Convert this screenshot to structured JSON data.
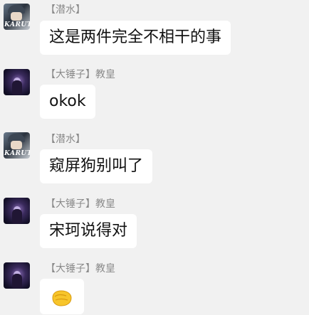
{
  "messages": [
    {
      "sender": "【潜水】",
      "text": "这是两件完全不相干的事",
      "avatar": "naruto-avatar"
    },
    {
      "sender": "【大锤子】教皇",
      "text": "okok",
      "avatar": "night-avatar"
    },
    {
      "sender": "【潜水】",
      "text": "窥屏狗别叫了",
      "avatar": "naruto-avatar"
    },
    {
      "sender": "【大锤子】教皇",
      "text": "宋珂说得对",
      "avatar": "night-avatar"
    },
    {
      "sender": "【大锤子】教皇",
      "text": "",
      "avatar": "night-avatar",
      "emoji": "thumbs-fist-emoji-icon"
    }
  ],
  "avatar_text": "KARUT",
  "colors": {
    "background": "#f1f1f1",
    "bubble": "#ffffff",
    "name": "#8a8a8a",
    "emoji": "#f7c52b"
  }
}
